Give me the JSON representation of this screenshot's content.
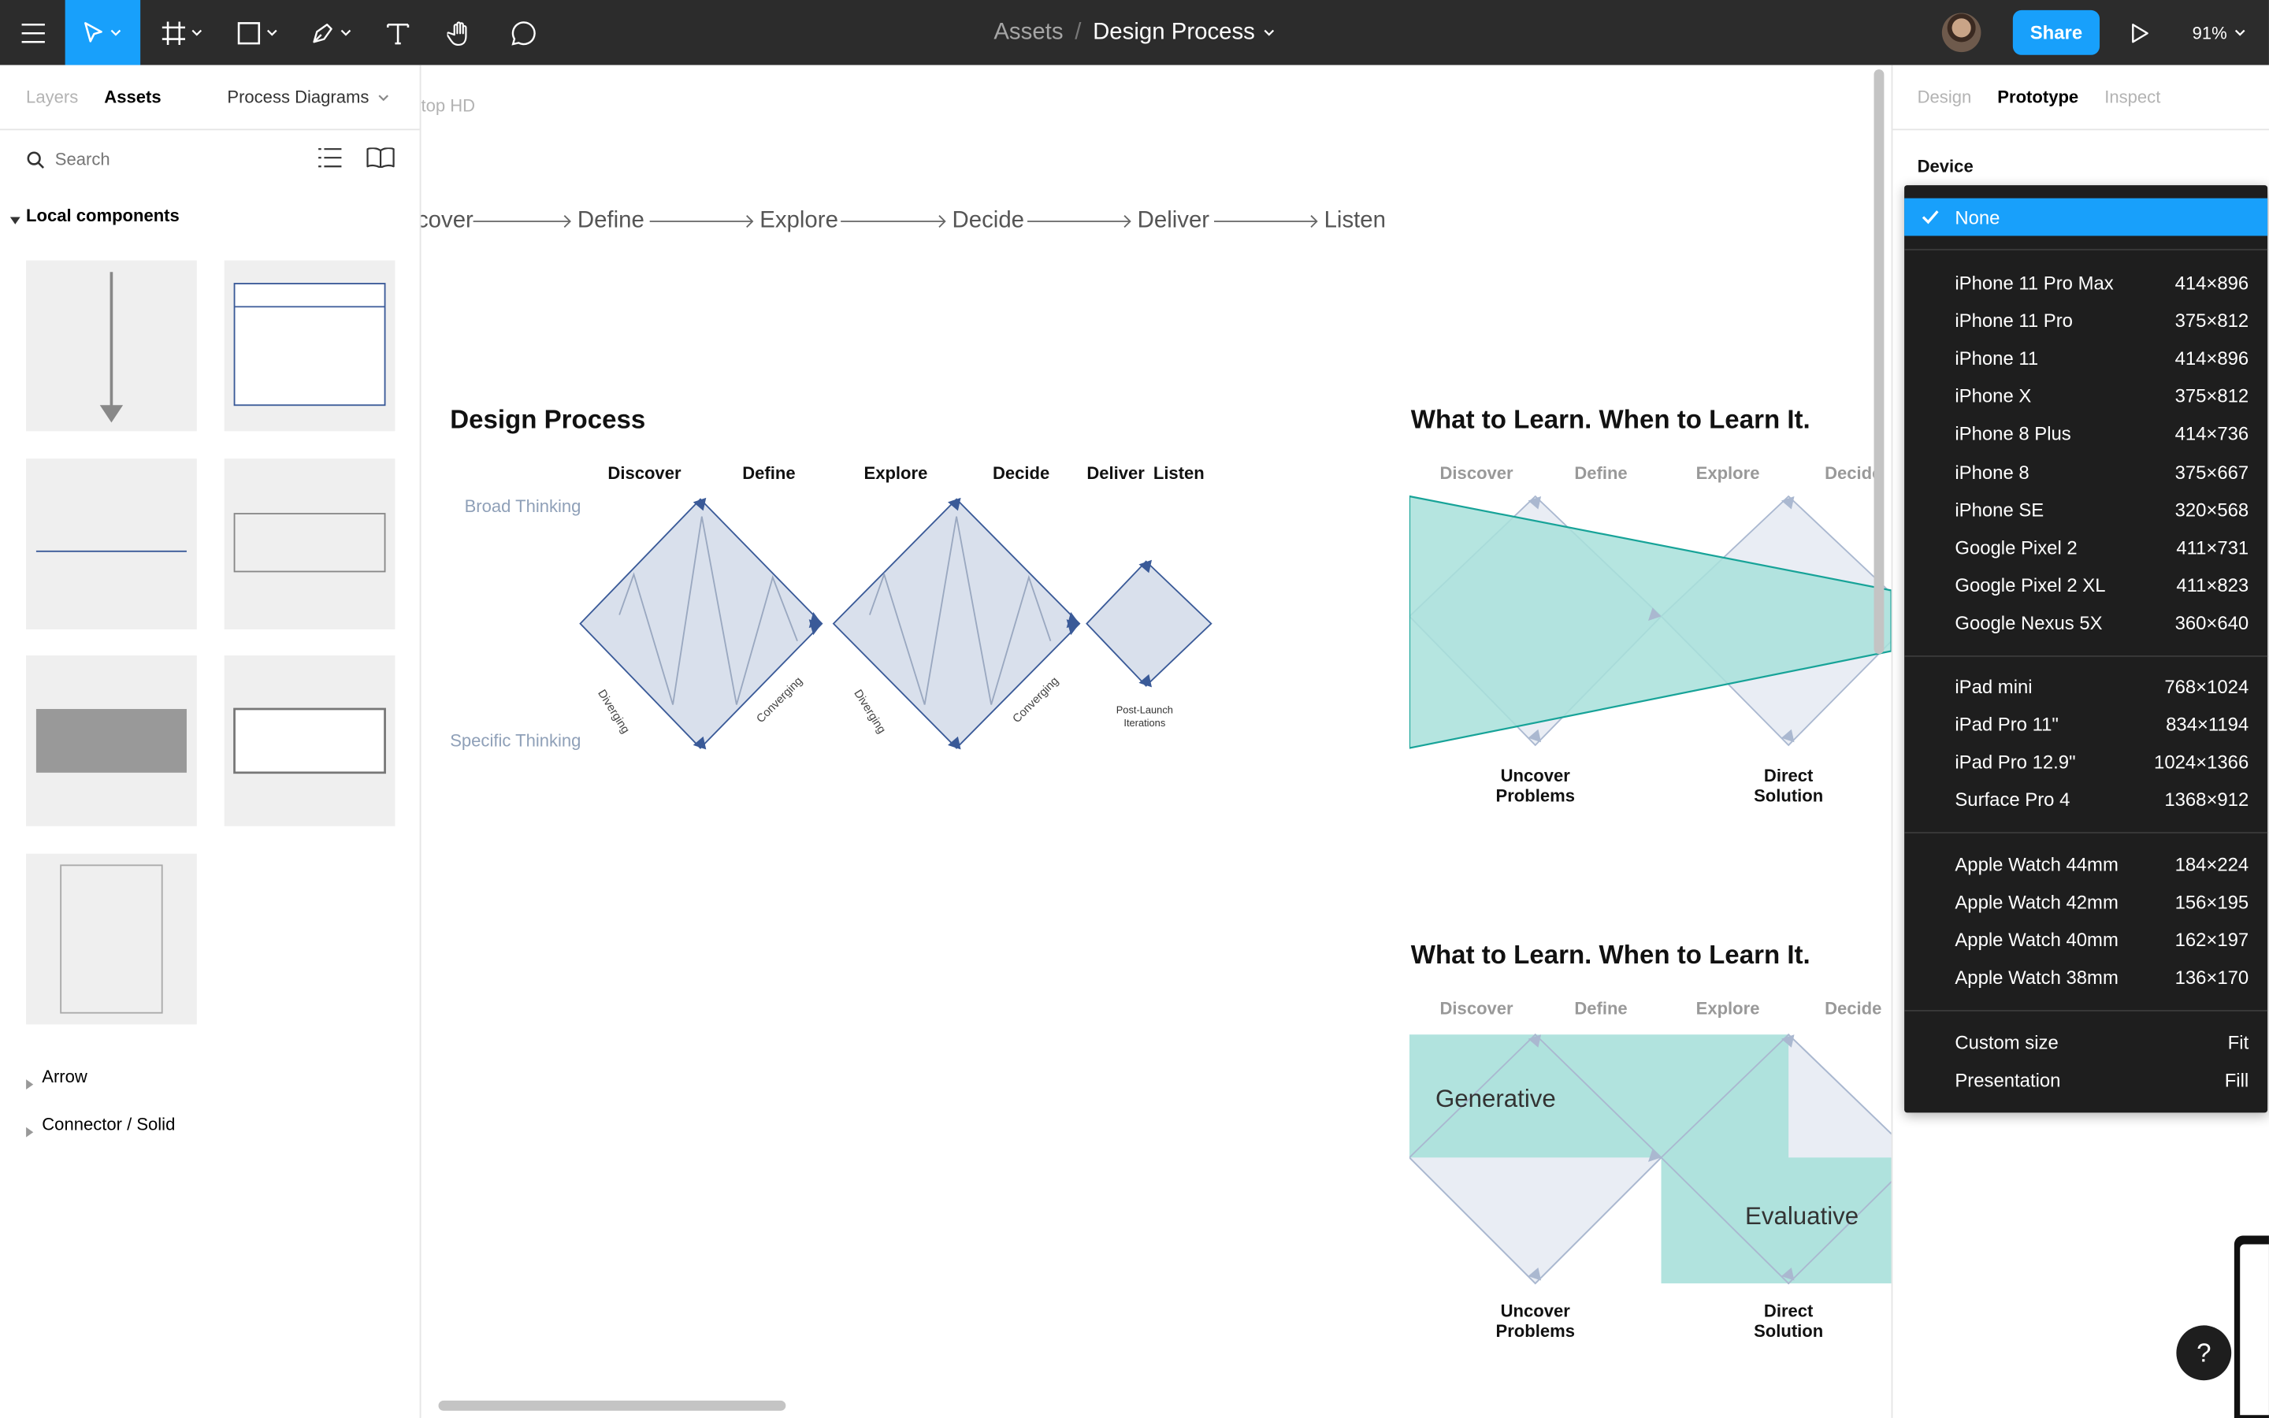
{
  "toolbar": {
    "breadcrumb_parent": "Assets",
    "separator": "/",
    "document_title": "Design Process",
    "share_label": "Share",
    "zoom_label": "91%"
  },
  "left_panel": {
    "tabs": [
      "Layers",
      "Assets"
    ],
    "library_label": "Process Diagrams",
    "search_placeholder": "Search",
    "section_title": "Local components",
    "groups": [
      "Arrow",
      "Connector / Solid"
    ]
  },
  "canvas": {
    "frame_label": "top HD",
    "flow_steps": [
      "cover",
      "Define",
      "Explore",
      "Decide",
      "Deliver",
      "Listen"
    ],
    "design_process": {
      "title": "Design Process",
      "phases": [
        "Discover",
        "Define",
        "Explore",
        "Decide",
        "Deliver",
        "Listen"
      ],
      "broad": "Broad Thinking",
      "specific": "Specific Thinking",
      "diverging": "Diverging",
      "converging": "Converging",
      "post_launch_1": "Post-Launch",
      "post_launch_2": "Iterations"
    },
    "learn_top": {
      "title": "What to Learn. When to Learn It.",
      "phases": [
        "Discover",
        "Define",
        "Explore",
        "Decide"
      ],
      "caption_left_1": "Uncover",
      "caption_left_2": "Problems",
      "caption_right_1": "Direct",
      "caption_right_2": "Solution"
    },
    "learn_bottom": {
      "title": "What to Learn. When to Learn It.",
      "phases": [
        "Discover",
        "Define",
        "Explore",
        "Decide"
      ],
      "generative": "Generative",
      "evaluative": "Evaluative",
      "caption_left_1": "Uncover",
      "caption_left_2": "Problems",
      "caption_right_1": "Direct",
      "caption_right_2": "Solution"
    },
    "colors": {
      "teal": "#a8e0da",
      "teal_line": "#17a398",
      "diamond": "#d9e0ec",
      "diamond_stroke": "#3a5a98"
    }
  },
  "right_panel": {
    "tabs": [
      "Design",
      "Prototype",
      "Inspect"
    ],
    "device_label": "Device"
  },
  "device_menu": {
    "selected": "None",
    "phones": [
      {
        "name": "iPhone 11 Pro Max",
        "size": "414×896"
      },
      {
        "name": "iPhone 11 Pro",
        "size": "375×812"
      },
      {
        "name": "iPhone 11",
        "size": "414×896"
      },
      {
        "name": "iPhone X",
        "size": "375×812"
      },
      {
        "name": "iPhone 8 Plus",
        "size": "414×736"
      },
      {
        "name": "iPhone 8",
        "size": "375×667"
      },
      {
        "name": "iPhone SE",
        "size": "320×568"
      },
      {
        "name": "Google Pixel 2",
        "size": "411×731"
      },
      {
        "name": "Google Pixel 2 XL",
        "size": "411×823"
      },
      {
        "name": "Google Nexus 5X",
        "size": "360×640"
      }
    ],
    "tablets": [
      {
        "name": "iPad mini",
        "size": "768×1024"
      },
      {
        "name": "iPad Pro 11\"",
        "size": "834×1194"
      },
      {
        "name": "iPad Pro 12.9\"",
        "size": "1024×1366"
      },
      {
        "name": "Surface Pro 4",
        "size": "1368×912"
      }
    ],
    "watches": [
      {
        "name": "Apple Watch 44mm",
        "size": "184×224"
      },
      {
        "name": "Apple Watch 42mm",
        "size": "156×195"
      },
      {
        "name": "Apple Watch 40mm",
        "size": "162×197"
      },
      {
        "name": "Apple Watch 38mm",
        "size": "136×170"
      }
    ],
    "extras": [
      {
        "name": "Custom size",
        "size": "Fit"
      },
      {
        "name": "Presentation",
        "size": "Fill"
      }
    ]
  },
  "help_label": "?"
}
